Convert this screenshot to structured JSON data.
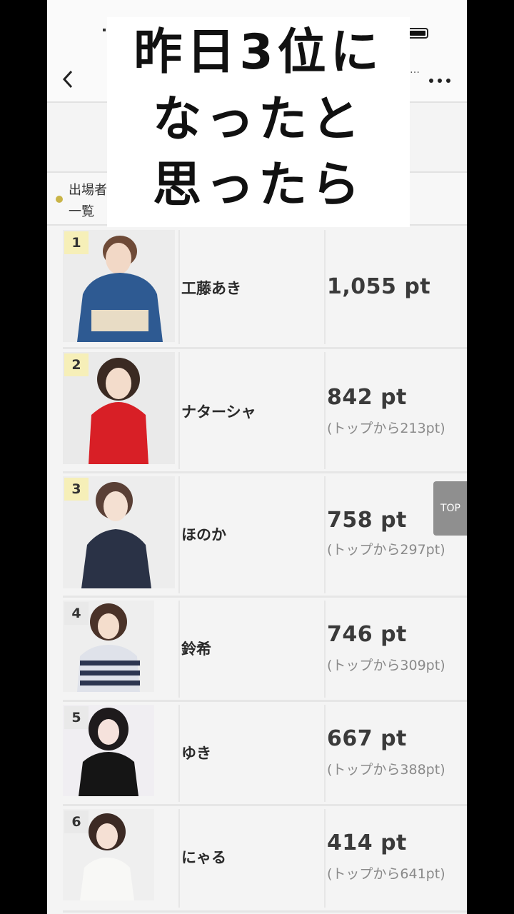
{
  "header": {
    "back_icon": "chevron-left-icon",
    "menu_icon": "more-horizontal-icon",
    "status_dots": "…"
  },
  "filter": {
    "label": "出場者一覧"
  },
  "caption": {
    "line1": "昨日3位に",
    "line2": "なったと",
    "line3": "思ったら"
  },
  "top_button": "TOP",
  "ranking": [
    {
      "rank": "1",
      "name": "工藤あき",
      "points": "1,055 pt",
      "gap": ""
    },
    {
      "rank": "2",
      "name": "ナターシャ",
      "points": "842 pt",
      "gap": "(トップから213pt)"
    },
    {
      "rank": "3",
      "name": "ほのか",
      "points": "758 pt",
      "gap": "(トップから297pt)"
    },
    {
      "rank": "4",
      "name": "鈴希",
      "points": "746 pt",
      "gap": "(トップから309pt)"
    },
    {
      "rank": "5",
      "name": "ゆき",
      "points": "667 pt",
      "gap": "(トップから388pt)"
    },
    {
      "rank": "6",
      "name": "にゃる",
      "points": "414 pt",
      "gap": "(トップから641pt)"
    }
  ],
  "colors": {
    "badge_top3": "#f6efb8",
    "badge_other": "#e9e9e9",
    "top_button": "#8f8f8f"
  }
}
